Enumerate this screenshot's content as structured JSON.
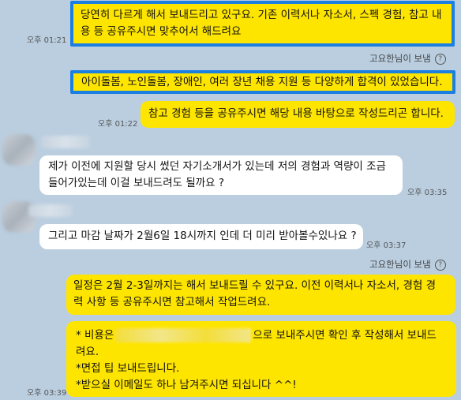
{
  "messages": [
    {
      "time": "오후 01:21",
      "lines": [
        "당연히 다르게 해서 보내드리고 있구요. 기존 이력서나 자소서, 스펙 경험, 참고 내",
        "용 등 공유주시면 맞추어서 해드려요"
      ]
    },
    {
      "sender": "고요한님이 보냄",
      "lines": [
        "아이돌봄, 노인돌봄, 장애인, 여러 장년 채용 지원 등 다양하게 합격이 있었습니다."
      ]
    },
    {
      "time": "오후 01:22",
      "lines": [
        "참고 경험 등을 공유주시면 해당 내용 바탕으로 작성드리곤 합니다."
      ]
    },
    {
      "time": "오후 03:35",
      "lines": [
        "제가 이전에 지원할 당시 썼던 자기소개서가 있는데 저의 경험과 역량이 조금",
        "들어가있는데 이걸 보내드려도 될까요 ?"
      ]
    },
    {
      "time": "오후 03:37",
      "lines": [
        "그리고 마감 날짜가 2월6일 18시까지 인데 더 미리 받아볼수있나요 ?"
      ]
    },
    {
      "sender": "고요한님이 보냄",
      "lines": [
        "일정은 2월 2-3일까지는 해서 보내드릴 수 있구요. 이전 이력서나 자소서, 경험 경",
        "력 사항 등 공유주시면 참고해서 작업드려요."
      ]
    },
    {
      "time": "오후 03:39",
      "lines": [
        "* 비용은",
        "으로 보내주시면 확인 후 작성해서 보내드",
        "려요.",
        "*면접 팁 보내드립니다.",
        "*받으실 이메일도 하나 남겨주시면 되십니다 ^^!"
      ]
    }
  ],
  "help_icon": "?"
}
